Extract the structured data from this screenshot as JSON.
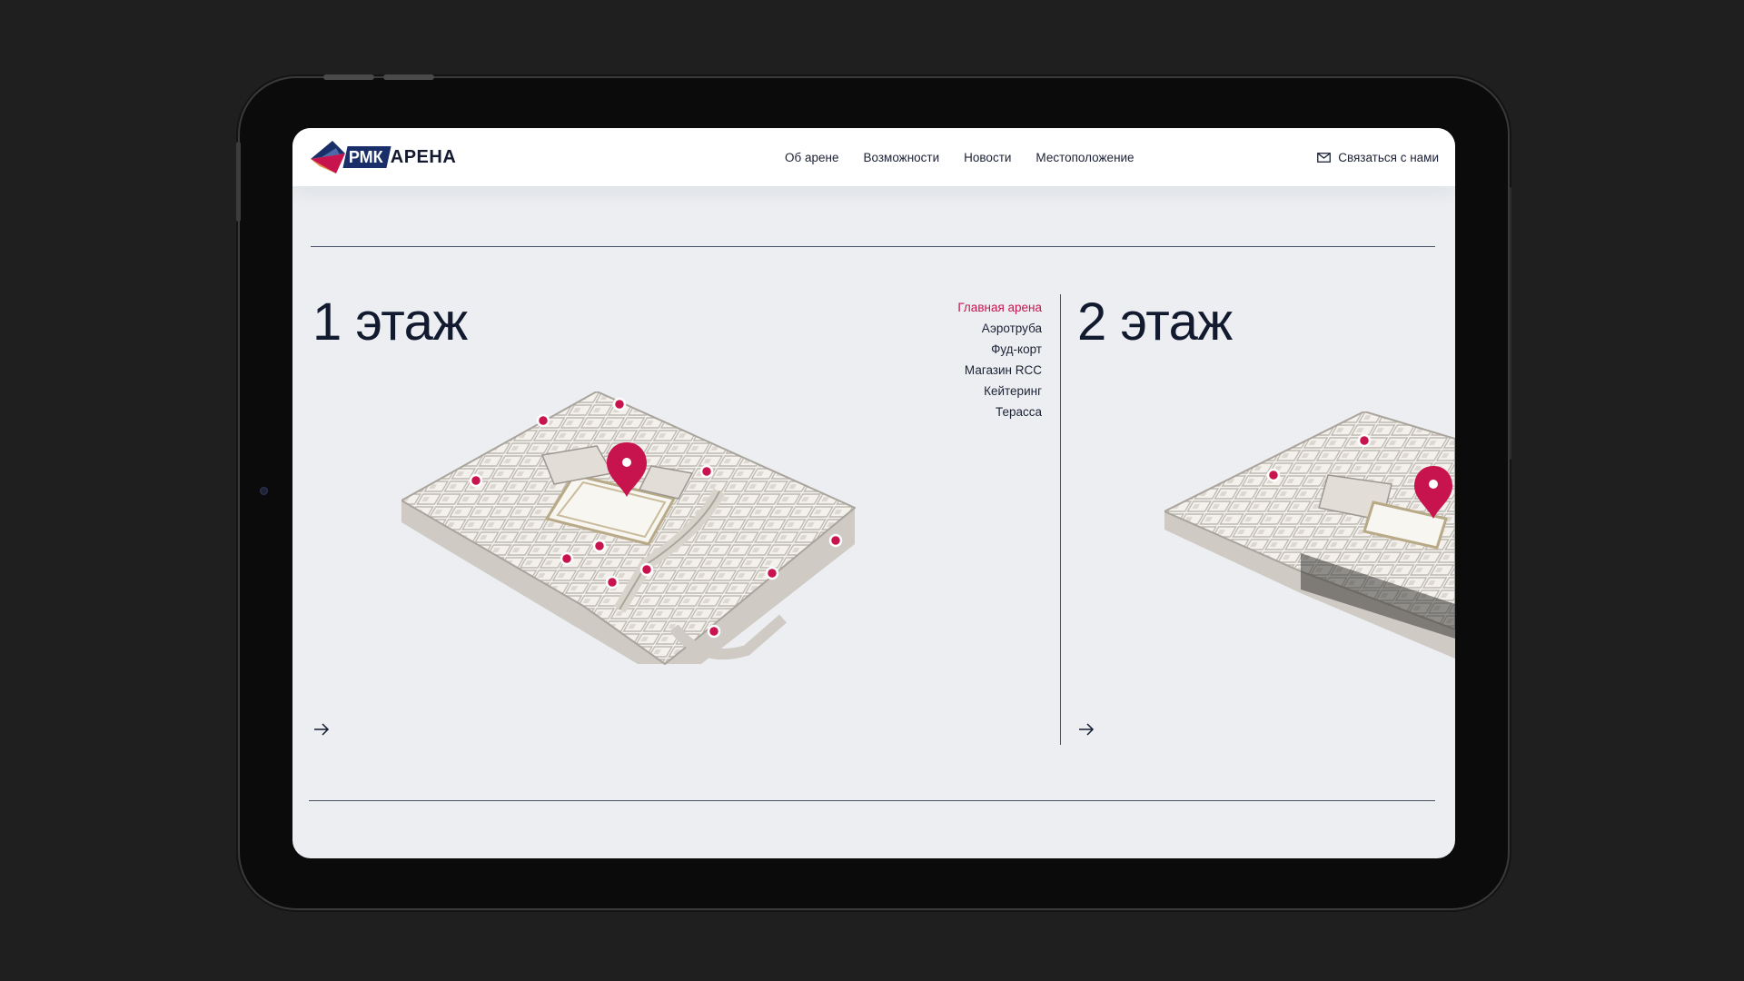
{
  "header": {
    "logo_box": "РМК",
    "logo_text": "АРЕНА",
    "nav": [
      {
        "label": "Об арене"
      },
      {
        "label": "Возможности"
      },
      {
        "label": "Новости"
      },
      {
        "label": "Местоположение"
      }
    ],
    "contact_label": "Связаться с нами"
  },
  "floors": [
    {
      "title": "1 этаж",
      "zones": [
        {
          "label": "Главная арена",
          "active": true
        },
        {
          "label": "Аэротруба",
          "active": false
        },
        {
          "label": "Фуд-корт",
          "active": false
        },
        {
          "label": "Магазин RCC",
          "active": false
        },
        {
          "label": "Кейтеринг",
          "active": false
        },
        {
          "label": "Терасса",
          "active": false
        }
      ]
    },
    {
      "title": "2 этаж"
    }
  ],
  "colors": {
    "accent": "#c8144e",
    "text": "#121a30",
    "screen_bg": "#eceef1",
    "logo_blue": "#1a2e6a"
  }
}
